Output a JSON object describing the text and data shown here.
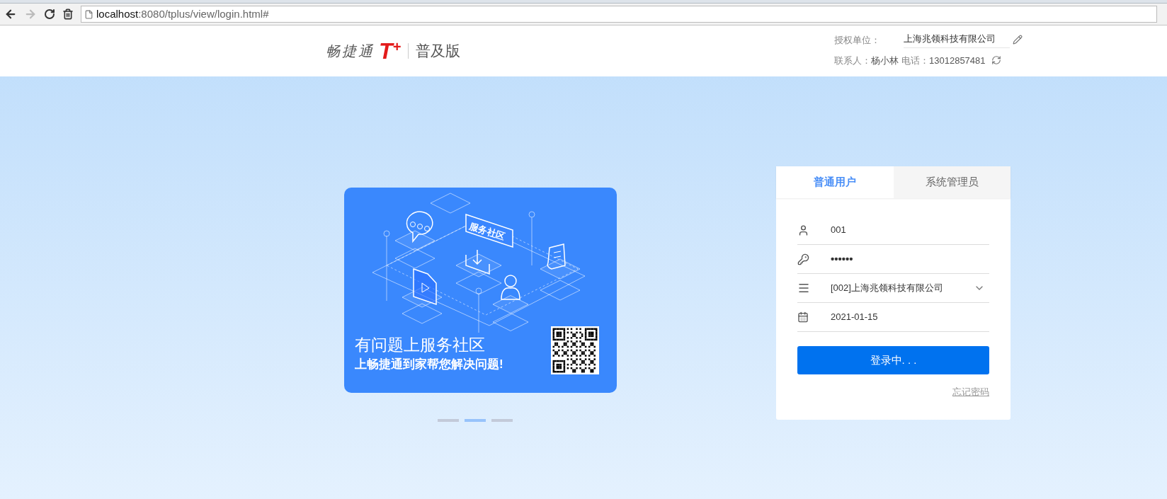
{
  "browser": {
    "url_host": "localhost",
    "url_path": ":8080/tplus/view/login.html#",
    "forward_disabled": true
  },
  "header": {
    "logo": {
      "name": "畅捷通",
      "mark": "T",
      "mark_sup": "+",
      "edition": "普及版"
    },
    "license_label": "授权单位：",
    "license_value": "上海兆领科技有限公司",
    "contact_label": "联系人：",
    "contact_name": "杨小林",
    "phone_label": "电话：",
    "phone": "13012857481"
  },
  "banner": {
    "sign_text": "服务社区",
    "title": "有问题上服务社区",
    "subtitle": "上畅捷通到家帮您解决问题!"
  },
  "carousel": [
    {
      "selected": false
    },
    {
      "selected": true
    },
    {
      "selected": false
    }
  ],
  "login": {
    "tabs": [
      {
        "label": "普通用户",
        "selected": true
      },
      {
        "label": "系统管理员",
        "selected": false
      }
    ],
    "fields": [
      {
        "kind": "user",
        "value": "001"
      },
      {
        "kind": "password",
        "value": "••••••"
      },
      {
        "kind": "select",
        "value": "[002]上海兆领科技有限公司"
      },
      {
        "kind": "date",
        "value": "2021-01-15"
      }
    ],
    "submit": "登录中. . .",
    "forgot": "忘记密码"
  }
}
